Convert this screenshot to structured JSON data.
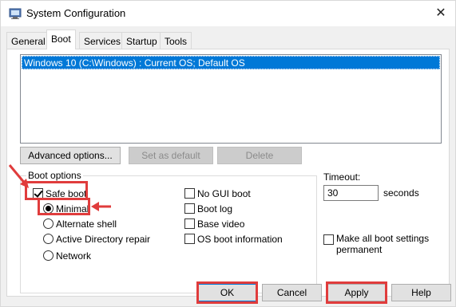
{
  "window": {
    "title": "System Configuration",
    "close_glyph": "✕"
  },
  "tabs": [
    {
      "label": "General"
    },
    {
      "label": "Boot"
    },
    {
      "label": "Services"
    },
    {
      "label": "Startup"
    },
    {
      "label": "Tools"
    }
  ],
  "os_list": {
    "items": [
      "Windows 10 (C:\\Windows) : Current OS; Default OS"
    ]
  },
  "buttons": {
    "advanced": "Advanced options...",
    "set_default": "Set as default",
    "delete": "Delete",
    "ok": "OK",
    "cancel": "Cancel",
    "apply": "Apply",
    "help": "Help"
  },
  "boot_options": {
    "legend": "Boot options",
    "safe_boot": "Safe boot",
    "minimal": "Minimal",
    "alternate_shell": "Alternate shell",
    "active_directory_repair": "Active Directory repair",
    "network": "Network",
    "no_gui_boot": "No GUI boot",
    "boot_log": "Boot log",
    "base_video": "Base video",
    "os_boot_information": "OS boot information"
  },
  "timeout": {
    "label": "Timeout:",
    "value": "30",
    "unit": "seconds"
  },
  "make_permanent": {
    "line1": "Make all boot settings",
    "line2": "permanent"
  },
  "colors": {
    "accent": "#0078d7",
    "annotation": "#e03c3c"
  }
}
